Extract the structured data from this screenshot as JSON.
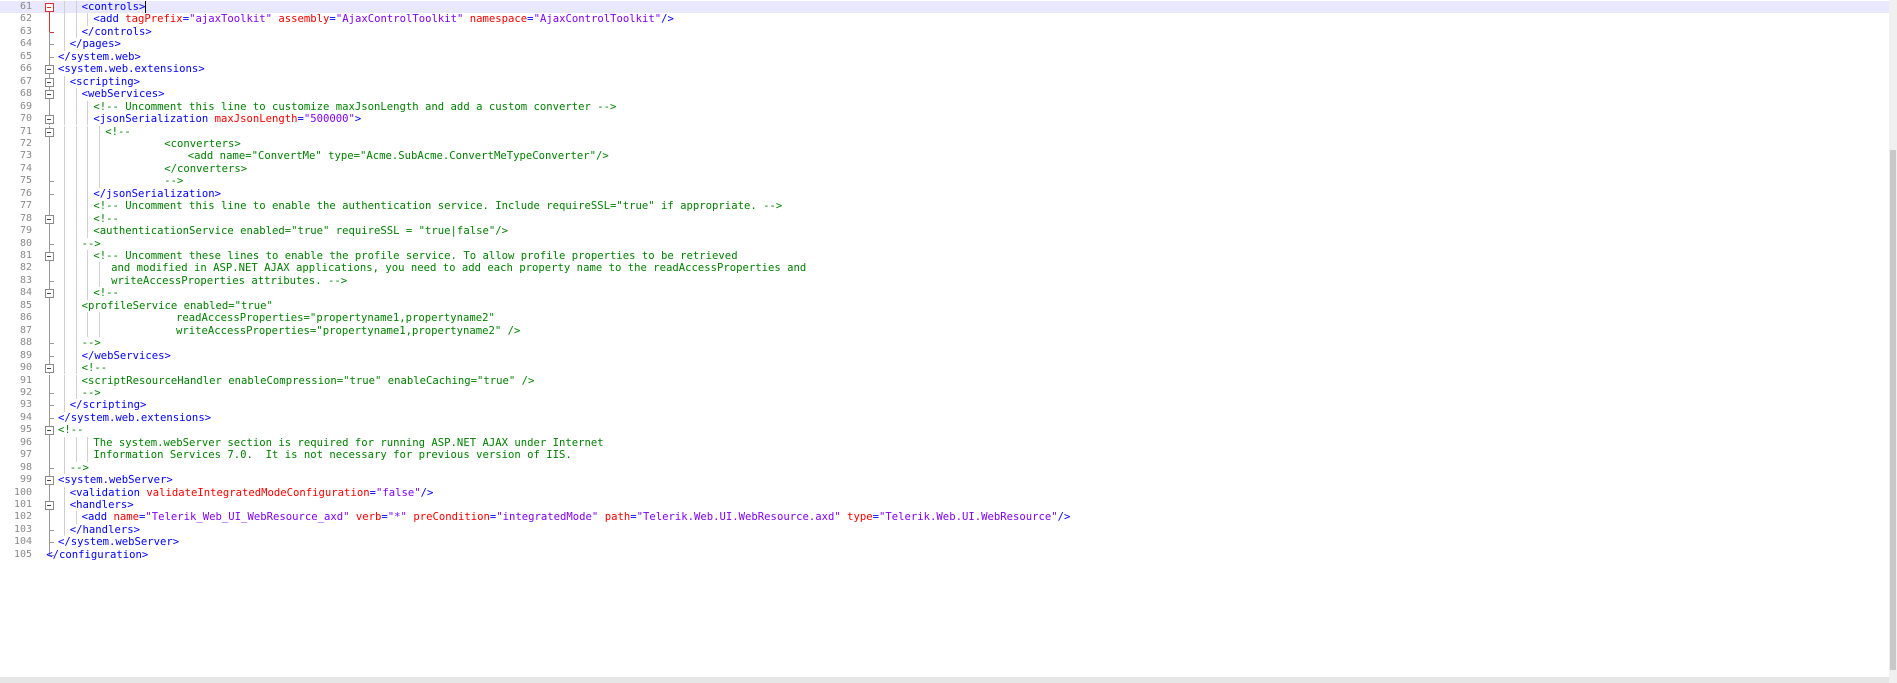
{
  "editor": {
    "lines": [
      {
        "n": "61",
        "fold": "red-box",
        "current": true,
        "ind": 2,
        "segs": [
          [
            "tag",
            "<controls>"
          ]
        ],
        "caret": true
      },
      {
        "n": "62",
        "fold": "red-bar",
        "ind": 3,
        "segs": [
          [
            "tag",
            "<add "
          ],
          [
            "attr",
            "tagPrefix"
          ],
          [
            "tag",
            "="
          ],
          [
            "val",
            "\"ajaxToolkit\""
          ],
          [
            "tag",
            " "
          ],
          [
            "attr",
            "assembly"
          ],
          [
            "tag",
            "="
          ],
          [
            "val",
            "\"AjaxControlToolkit\""
          ],
          [
            "tag",
            " "
          ],
          [
            "attr",
            "namespace"
          ],
          [
            "tag",
            "="
          ],
          [
            "val",
            "\"AjaxControlToolkit\""
          ],
          [
            "tag",
            "/>"
          ]
        ]
      },
      {
        "n": "63",
        "fold": "red-end",
        "ind": 2,
        "segs": [
          [
            "tag",
            "</controls>"
          ]
        ]
      },
      {
        "n": "64",
        "fold": "end",
        "ind": 1,
        "segs": [
          [
            "tag",
            "</pages>"
          ]
        ]
      },
      {
        "n": "65",
        "fold": "end",
        "ind": 0,
        "segs": [
          [
            "tag",
            "</system.web>"
          ]
        ]
      },
      {
        "n": "66",
        "fold": "box",
        "ind": 0,
        "segs": [
          [
            "tag",
            "<system.web.extensions>"
          ]
        ]
      },
      {
        "n": "67",
        "fold": "box",
        "ind": 1,
        "segs": [
          [
            "tag",
            "<scripting>"
          ]
        ]
      },
      {
        "n": "68",
        "fold": "box",
        "ind": 2,
        "segs": [
          [
            "tag",
            "<webServices>"
          ]
        ]
      },
      {
        "n": "69",
        "fold": "bar",
        "ind": 3,
        "segs": [
          [
            "cmt",
            "<!-- Uncomment this line to customize maxJsonLength and add a custom converter -->"
          ]
        ]
      },
      {
        "n": "70",
        "fold": "box",
        "ind": 3,
        "segs": [
          [
            "tag",
            "<jsonSerialization "
          ],
          [
            "attr",
            "maxJsonLength"
          ],
          [
            "tag",
            "="
          ],
          [
            "val",
            "\"500000\""
          ],
          [
            "tag",
            ">"
          ]
        ]
      },
      {
        "n": "71",
        "fold": "box",
        "ind": 4,
        "segs": [
          [
            "cmt",
            "<!--"
          ]
        ]
      },
      {
        "n": "72",
        "fold": "bar",
        "ind": 9,
        "segs": [
          [
            "cmt",
            "<converters>"
          ]
        ]
      },
      {
        "n": "73",
        "fold": "bar",
        "ind": 11,
        "segs": [
          [
            "cmt",
            "<add name=\"ConvertMe\" type=\"Acme.SubAcme.ConvertMeTypeConverter\"/>"
          ]
        ]
      },
      {
        "n": "74",
        "fold": "bar",
        "ind": 9,
        "segs": [
          [
            "cmt",
            "</converters>"
          ]
        ]
      },
      {
        "n": "75",
        "fold": "end",
        "ind": 9,
        "segs": [
          [
            "cmt",
            "-->"
          ]
        ]
      },
      {
        "n": "76",
        "fold": "end",
        "ind": 3,
        "segs": [
          [
            "tag",
            "</jsonSerialization>"
          ]
        ]
      },
      {
        "n": "77",
        "fold": "bar",
        "ind": 3,
        "segs": [
          [
            "cmt",
            "<!-- Uncomment this line to enable the authentication service. Include requireSSL=\"true\" if appropriate. -->"
          ]
        ]
      },
      {
        "n": "78",
        "fold": "box",
        "ind": 3,
        "segs": [
          [
            "cmt",
            "<!--"
          ]
        ]
      },
      {
        "n": "79",
        "fold": "bar",
        "ind": 3,
        "segs": [
          [
            "cmt",
            "<authenticationService enabled=\"true\" requireSSL = \"true|false\"/>"
          ]
        ]
      },
      {
        "n": "80",
        "fold": "end",
        "ind": 2,
        "segs": [
          [
            "cmt",
            "-->"
          ]
        ]
      },
      {
        "n": "81",
        "fold": "box",
        "ind": 3,
        "segs": [
          [
            "cmt",
            "<!-- Uncomment these lines to enable the profile service. To allow profile properties to be retrieved"
          ]
        ]
      },
      {
        "n": "82",
        "fold": "bar",
        "ind": 4.5,
        "segs": [
          [
            "cmt",
            "and modified in ASP.NET AJAX applications, you need to add each property name to the readAccessProperties and"
          ]
        ]
      },
      {
        "n": "83",
        "fold": "end",
        "ind": 4.5,
        "segs": [
          [
            "cmt",
            "writeAccessProperties attributes. -->"
          ]
        ]
      },
      {
        "n": "84",
        "fold": "box",
        "ind": 3,
        "segs": [
          [
            "cmt",
            "<!--"
          ]
        ]
      },
      {
        "n": "85",
        "fold": "bar",
        "ind": 2,
        "segs": [
          [
            "cmt",
            "<profileService enabled=\"true\""
          ]
        ]
      },
      {
        "n": "86",
        "fold": "bar",
        "ind": 10,
        "segs": [
          [
            "cmt",
            "readAccessProperties=\"propertyname1,propertyname2\""
          ]
        ]
      },
      {
        "n": "87",
        "fold": "bar",
        "ind": 10,
        "segs": [
          [
            "cmt",
            "writeAccessProperties=\"propertyname1,propertyname2\" />"
          ]
        ]
      },
      {
        "n": "88",
        "fold": "end",
        "ind": 2,
        "segs": [
          [
            "cmt",
            "-->"
          ]
        ]
      },
      {
        "n": "89",
        "fold": "end",
        "ind": 2,
        "segs": [
          [
            "tag",
            "</webServices>"
          ]
        ]
      },
      {
        "n": "90",
        "fold": "box",
        "ind": 2,
        "segs": [
          [
            "cmt",
            "<!--"
          ]
        ]
      },
      {
        "n": "91",
        "fold": "bar",
        "ind": 2,
        "segs": [
          [
            "cmt",
            "<scriptResourceHandler enableCompression=\"true\" enableCaching=\"true\" />"
          ]
        ]
      },
      {
        "n": "92",
        "fold": "end",
        "ind": 2,
        "segs": [
          [
            "cmt",
            "-->"
          ]
        ]
      },
      {
        "n": "93",
        "fold": "end",
        "ind": 1,
        "segs": [
          [
            "tag",
            "</scripting>"
          ]
        ]
      },
      {
        "n": "94",
        "fold": "end",
        "ind": 0,
        "segs": [
          [
            "tag",
            "</system.web.extensions>"
          ]
        ]
      },
      {
        "n": "95",
        "fold": "box",
        "ind": 0,
        "segs": [
          [
            "cmt",
            "<!--"
          ]
        ]
      },
      {
        "n": "96",
        "fold": "bar",
        "ind": 3,
        "segs": [
          [
            "cmt",
            "The system.webServer section is required for running ASP.NET AJAX under Internet"
          ]
        ]
      },
      {
        "n": "97",
        "fold": "bar",
        "ind": 3,
        "segs": [
          [
            "cmt",
            "Information Services 7.0.  It is not necessary for previous version of IIS."
          ]
        ]
      },
      {
        "n": "98",
        "fold": "end",
        "ind": 1,
        "segs": [
          [
            "cmt",
            "-->"
          ]
        ]
      },
      {
        "n": "99",
        "fold": "box",
        "ind": 0,
        "segs": [
          [
            "tag",
            "<system.webServer>"
          ]
        ]
      },
      {
        "n": "100",
        "fold": "bar",
        "ind": 1,
        "segs": [
          [
            "tag",
            "<validation "
          ],
          [
            "attr",
            "validateIntegratedModeConfiguration"
          ],
          [
            "tag",
            "="
          ],
          [
            "val",
            "\"false\""
          ],
          [
            "tag",
            "/>"
          ]
        ]
      },
      {
        "n": "101",
        "fold": "box",
        "ind": 1,
        "segs": [
          [
            "tag",
            "<handlers>"
          ]
        ]
      },
      {
        "n": "102",
        "fold": "bar",
        "ind": 2,
        "segs": [
          [
            "tag",
            "<add "
          ],
          [
            "attr",
            "name"
          ],
          [
            "tag",
            "="
          ],
          [
            "val",
            "\"Telerik_Web_UI_WebResource_axd\""
          ],
          [
            "tag",
            " "
          ],
          [
            "attr",
            "verb"
          ],
          [
            "tag",
            "="
          ],
          [
            "val",
            "\"*\""
          ],
          [
            "tag",
            " "
          ],
          [
            "attr",
            "preCondition"
          ],
          [
            "tag",
            "="
          ],
          [
            "val",
            "\"integratedMode\""
          ],
          [
            "tag",
            " "
          ],
          [
            "attr",
            "path"
          ],
          [
            "tag",
            "="
          ],
          [
            "val",
            "\"Telerik.Web.UI.WebResource.axd\""
          ],
          [
            "tag",
            " "
          ],
          [
            "attr",
            "type"
          ],
          [
            "tag",
            "="
          ],
          [
            "val",
            "\"Telerik.Web.UI.WebResource\""
          ],
          [
            "tag",
            "/>"
          ]
        ]
      },
      {
        "n": "103",
        "fold": "end",
        "ind": 1,
        "segs": [
          [
            "tag",
            "</handlers>"
          ]
        ]
      },
      {
        "n": "104",
        "fold": "end",
        "ind": 0,
        "segs": [
          [
            "tag",
            "</system.webServer>"
          ]
        ]
      },
      {
        "n": "105",
        "fold": "last",
        "ind": -1,
        "segs": [
          [
            "tag",
            "</configuration>"
          ]
        ]
      }
    ]
  },
  "colors": {
    "tag": "#0000ff",
    "attr": "#ff0000",
    "value": "#8000ff",
    "comment": "#008000",
    "current_line": "#e8e8ff"
  }
}
